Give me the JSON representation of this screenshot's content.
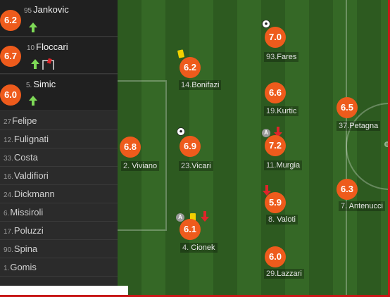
{
  "substitutes_in": [
    {
      "number": "95",
      "name": "Jankovic",
      "rating": "6.2",
      "icons": [
        "sub-in-arrow"
      ]
    },
    {
      "number": "10",
      "name": "Floccari",
      "rating": "6.7",
      "icons": [
        "sub-in-arrow",
        "red-card-glyph"
      ]
    },
    {
      "number": "5.",
      "name": "Simic",
      "rating": "6.0",
      "icons": [
        "sub-in-arrow"
      ]
    }
  ],
  "bench": [
    {
      "number": "27",
      "name": "Felipe"
    },
    {
      "number": "12.",
      "name": "Fulignati"
    },
    {
      "number": "33.",
      "name": "Costa"
    },
    {
      "number": "16.",
      "name": "Valdifiori"
    },
    {
      "number": "24.",
      "name": "Dickmann"
    },
    {
      "number": "6.",
      "name": "Missiroli"
    },
    {
      "number": "17.",
      "name": "Poluzzi"
    },
    {
      "number": "90.",
      "name": "Spina"
    },
    {
      "number": "1.",
      "name": "Gomis"
    }
  ],
  "players": {
    "viviano": {
      "number": "2.",
      "name": "Viviano",
      "rating": "6.8"
    },
    "bonifazi": {
      "number": "14.",
      "name": "Bonifazi",
      "rating": "6.2"
    },
    "vicari": {
      "number": "23.",
      "name": "Vicari",
      "rating": "6.9"
    },
    "cionek": {
      "number": "4.",
      "name": "Cionek",
      "rating": "6.1"
    },
    "fares": {
      "number": "93.",
      "name": "Fares",
      "rating": "7.0"
    },
    "kurtic": {
      "number": "19.",
      "name": "Kurtic",
      "rating": "6.6"
    },
    "murgia": {
      "number": "11.",
      "name": "Murgia",
      "rating": "7.2"
    },
    "valoti": {
      "number": "8.",
      "name": "Valoti",
      "rating": "5.9"
    },
    "lazzari": {
      "number": "29.",
      "name": "Lazzari",
      "rating": "6.0"
    },
    "petagna": {
      "number": "37.",
      "name": "Petagna",
      "rating": "6.5"
    },
    "antenucci": {
      "number": "7.",
      "name": "Antenucci",
      "rating": "6.3"
    }
  },
  "assist_glyph": "A",
  "colors": {
    "rating_bg": "#ee5b1c",
    "pitch_dark": "#2d5a20",
    "pitch_light": "#356826",
    "sub_in": "#7ed957",
    "sub_out": "#e0242a",
    "yellow_card": "#f2d000",
    "frame_border": "#c81818"
  }
}
